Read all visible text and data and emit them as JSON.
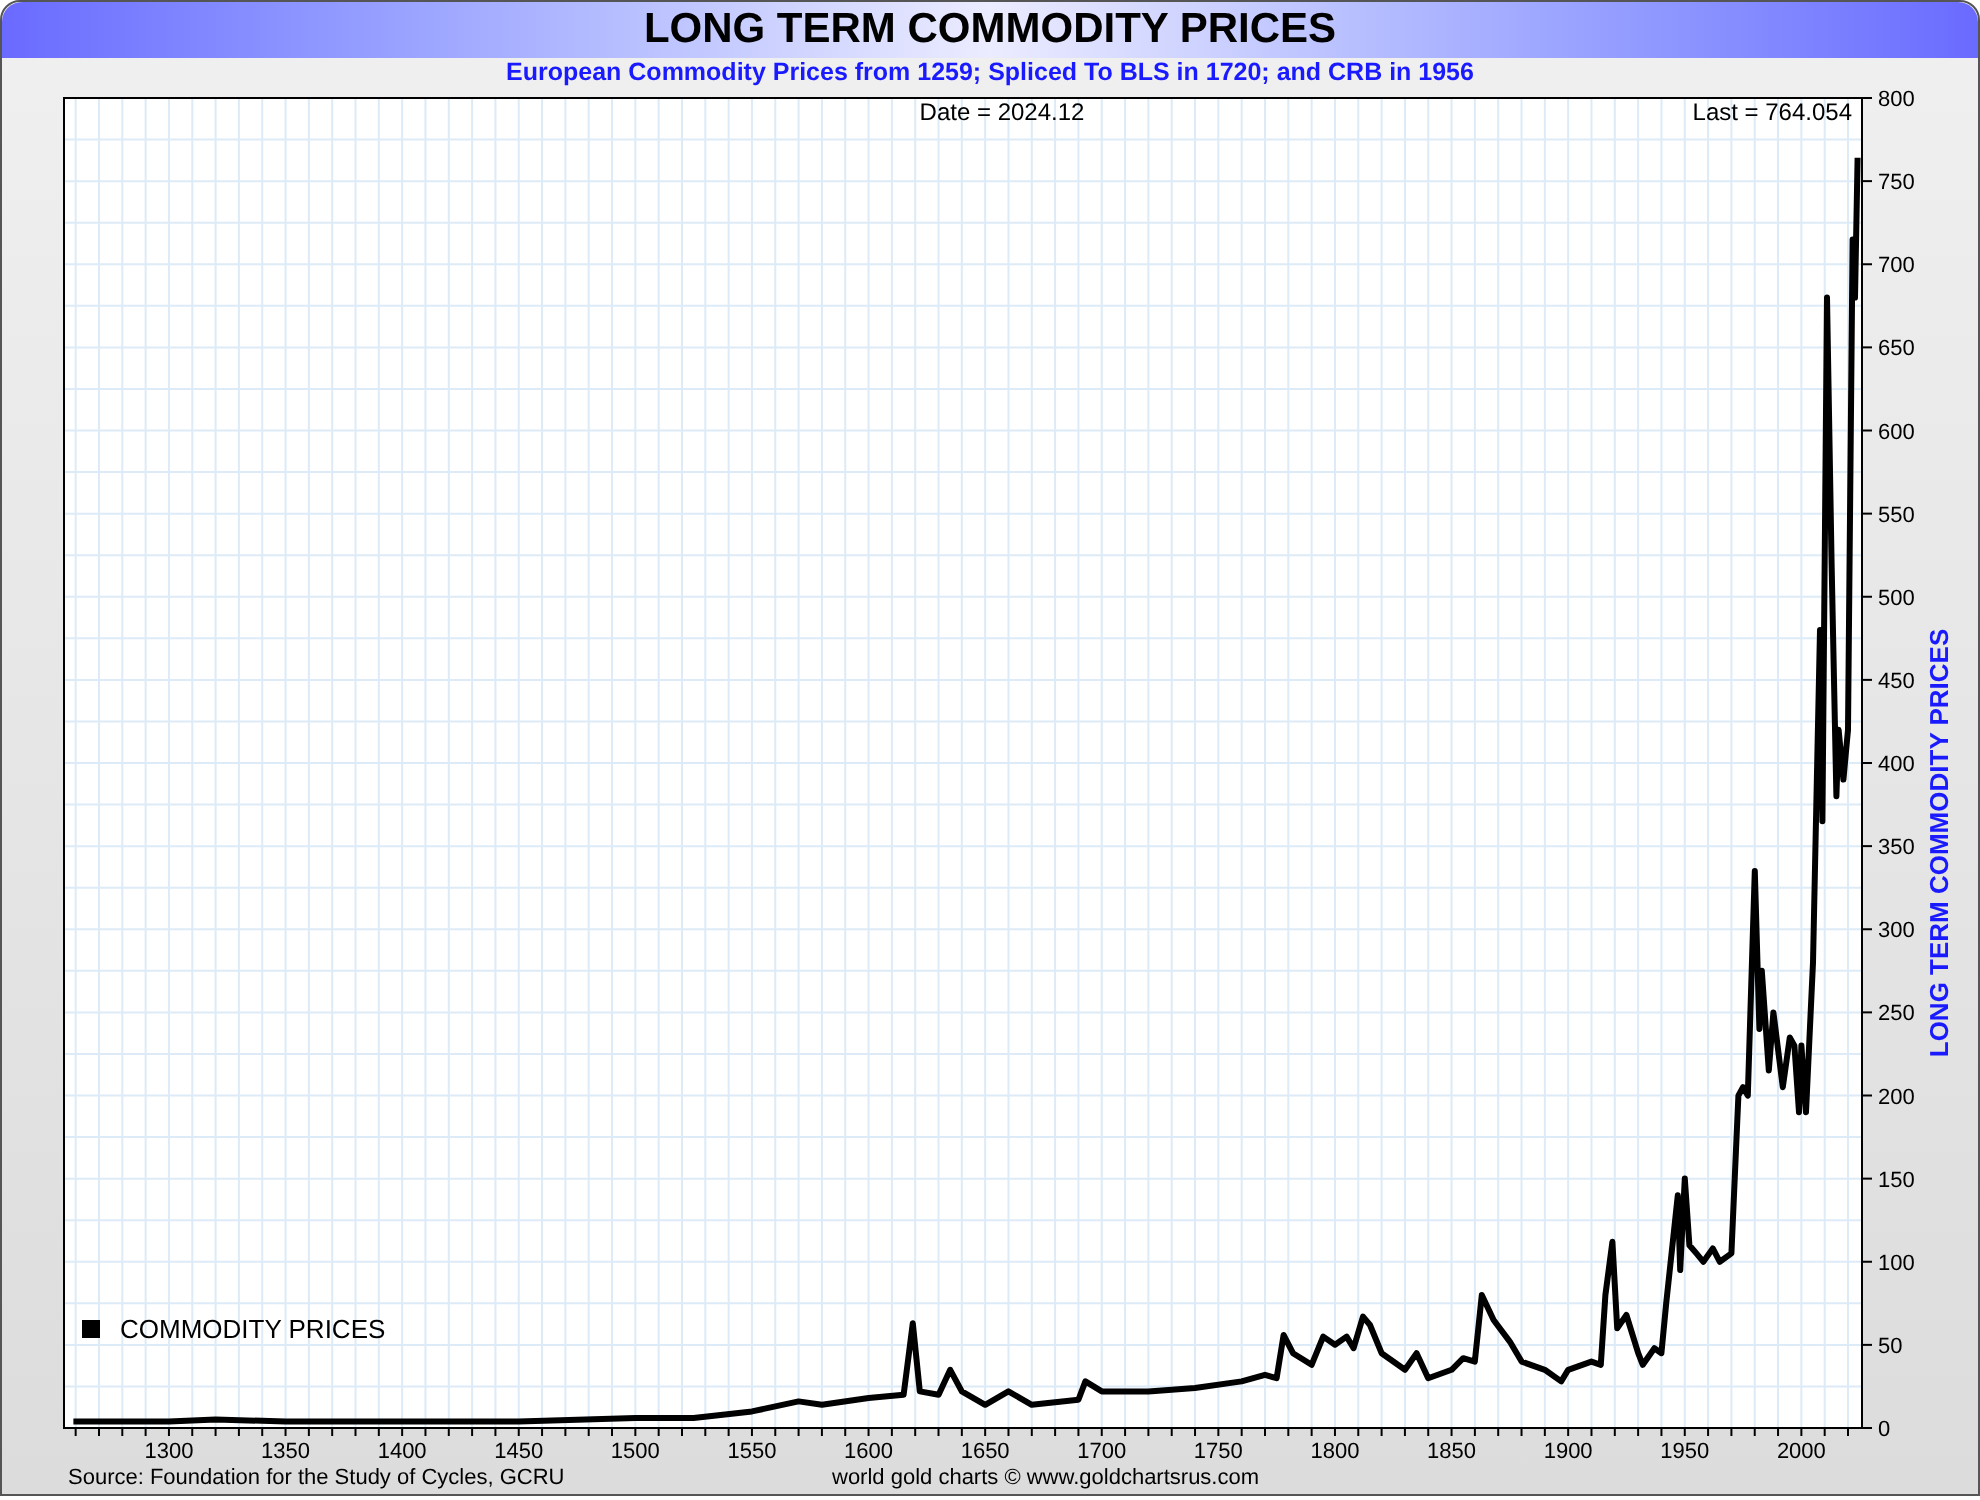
{
  "title": "LONG TERM COMMODITY PRICES",
  "subtitle": "European Commodity Prices from 1259; Spliced To BLS in 1720; and CRB in 1956",
  "chart_data": {
    "type": "line",
    "ylabel": "LONG TERM COMMODITY PRICES",
    "x": [
      1259,
      1300,
      1320,
      1350,
      1400,
      1450,
      1500,
      1525,
      1550,
      1570,
      1580,
      1600,
      1615,
      1619,
      1622,
      1630,
      1635,
      1640,
      1650,
      1660,
      1670,
      1690,
      1693,
      1700,
      1720,
      1740,
      1760,
      1770,
      1775,
      1778,
      1782,
      1790,
      1795,
      1800,
      1805,
      1808,
      1812,
      1815,
      1820,
      1830,
      1835,
      1840,
      1850,
      1855,
      1860,
      1863,
      1868,
      1875,
      1880,
      1890,
      1897,
      1900,
      1910,
      1914,
      1916,
      1919,
      1921,
      1925,
      1930,
      1932,
      1937,
      1940,
      1942,
      1947,
      1948,
      1950,
      1952,
      1955,
      1958,
      1962,
      1965,
      1970,
      1973,
      1975,
      1977,
      1980,
      1982,
      1983,
      1986,
      1988,
      1992,
      1995,
      1997,
      1999,
      2000,
      2002,
      2005,
      2008,
      2009,
      2011,
      2013,
      2015,
      2016,
      2018,
      2020,
      2022,
      2023,
      2024.12
    ],
    "series": [
      {
        "name": "COMMODITY PRICES",
        "color": "#000000",
        "values": [
          4,
          4,
          5,
          4,
          4,
          4,
          6,
          6,
          10,
          16,
          14,
          18,
          20,
          63,
          22,
          20,
          35,
          22,
          14,
          22,
          14,
          17,
          28,
          22,
          22,
          24,
          28,
          32,
          30,
          56,
          45,
          38,
          55,
          50,
          55,
          48,
          67,
          62,
          45,
          35,
          45,
          30,
          35,
          42,
          40,
          80,
          65,
          52,
          40,
          35,
          28,
          35,
          40,
          38,
          80,
          112,
          60,
          68,
          45,
          38,
          48,
          45,
          75,
          140,
          95,
          150,
          110,
          105,
          100,
          108,
          100,
          105,
          200,
          205,
          200,
          335,
          240,
          275,
          215,
          250,
          205,
          235,
          230,
          190,
          230,
          190,
          280,
          480,
          365,
          680,
          520,
          380,
          420,
          390,
          420,
          715,
          680,
          764
        ]
      }
    ],
    "xlim": [
      1255,
      2026
    ],
    "ylim": [
      0,
      800
    ],
    "grid": true,
    "xticks": [
      1300,
      1350,
      1400,
      1450,
      1500,
      1550,
      1600,
      1650,
      1700,
      1750,
      1800,
      1850,
      1900,
      1950,
      2000
    ],
    "yticks": [
      0,
      50,
      100,
      150,
      200,
      250,
      300,
      350,
      400,
      450,
      500,
      550,
      600,
      650,
      700,
      750,
      800
    ],
    "annotations": [
      "Date = 2024.12",
      "Last = 764.054"
    ]
  },
  "source": "Source: Foundation for the Study of Cycles, GCRU",
  "credit": "world gold charts © www.goldchartsrus.com"
}
